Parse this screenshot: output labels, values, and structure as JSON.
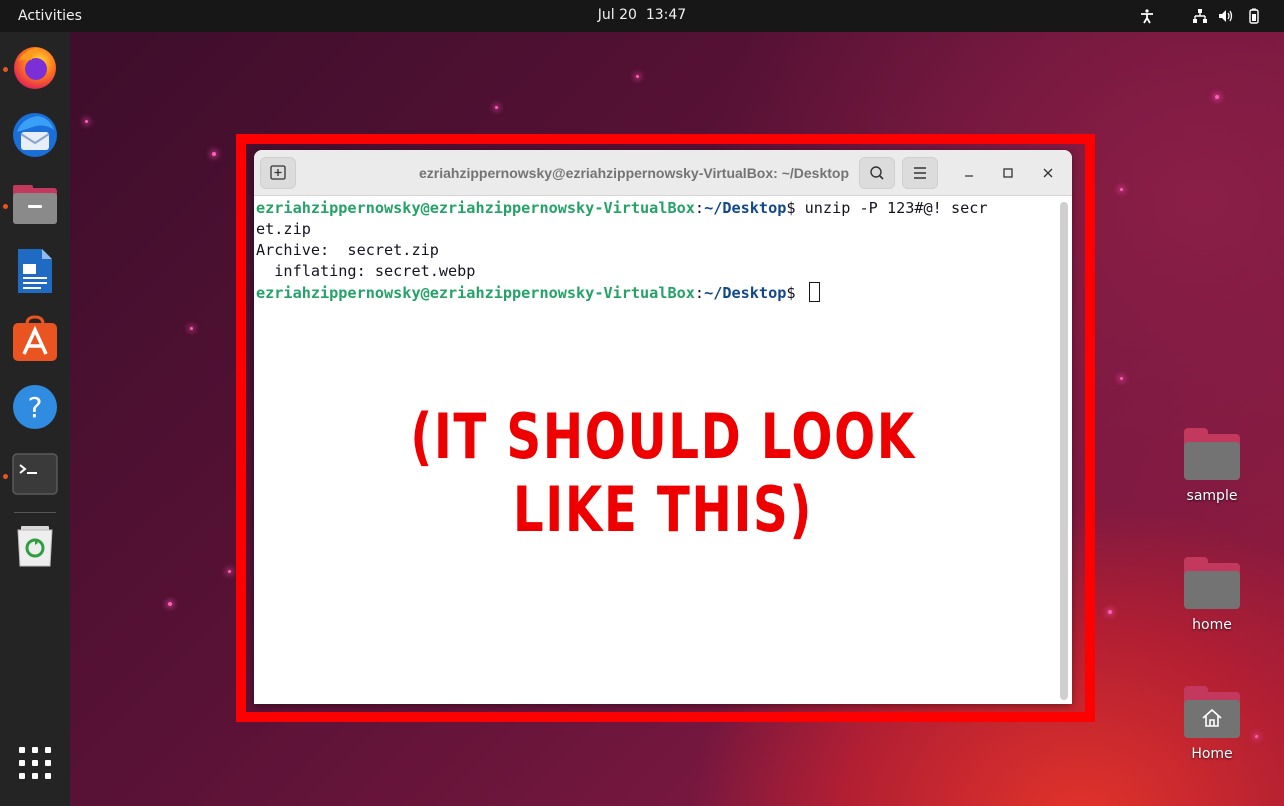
{
  "topbar": {
    "activities": "Activities",
    "date": "Jul 20",
    "time": "13:47",
    "tray_icons": [
      "accessibility-icon",
      "network-icon",
      "volume-icon",
      "battery-icon"
    ]
  },
  "dock": {
    "items": [
      {
        "name": "firefox",
        "running": true
      },
      {
        "name": "thunderbird",
        "running": false
      },
      {
        "name": "files",
        "running": true
      },
      {
        "name": "libreoffice-writer",
        "running": false
      },
      {
        "name": "ubuntu-software",
        "running": false
      },
      {
        "name": "help",
        "running": false
      },
      {
        "name": "terminal",
        "running": true
      },
      {
        "name": "trash",
        "running": false
      }
    ],
    "show_apps": "show-applications-icon"
  },
  "terminal": {
    "title": "ezriahzippernowsky@ezriahzippernowsky-VirtualBox: ~/Desktop",
    "lines": [
      {
        "user": "ezriahzippernowsky@ezriahzippernowsky-VirtualBox",
        "sep": ":",
        "path": "~/Desktop",
        "cmd": "$ unzip -P 123#@! secr"
      },
      {
        "text": "et.zip"
      },
      {
        "text": "Archive:  secret.zip"
      },
      {
        "text": "  inflating: secret.webp"
      },
      {
        "user": "ezriahzippernowsky@ezriahzippernowsky-VirtualBox",
        "sep": ":",
        "path": "~/Desktop",
        "cmd": "$ "
      }
    ]
  },
  "annotation": "(IT SHOULD LOOK LIKE THIS)",
  "desktop": {
    "icons": [
      {
        "label": "sample"
      },
      {
        "label": "home"
      },
      {
        "label": "Home"
      }
    ]
  },
  "colors": {
    "frame": "#ff0000",
    "prompt_user": "#26a269",
    "prompt_path": "#12488b",
    "accent": "#e95420"
  }
}
